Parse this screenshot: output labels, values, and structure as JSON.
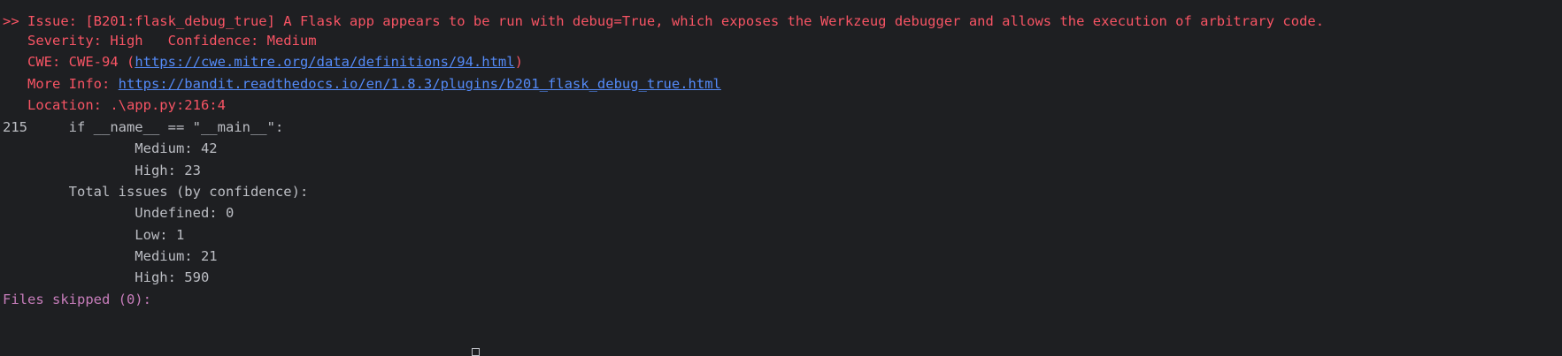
{
  "terminal": {
    "lines": {
      "issue": ">> Issue: [B201:flask_debug_true] A Flask app appears to be run with debug=True, which exposes the Werkzeug debugger and allows the execution of arbitrary code.",
      "severity": "   Severity: High   Confidence: Medium",
      "cwe_prefix": "   CWE: CWE-94 (",
      "cwe_link": "https://cwe.mitre.org/data/definitions/94.html",
      "cwe_suffix": ")",
      "more_info_prefix": "   More Info: ",
      "more_info_link": "https://bandit.readthedocs.io/en/1.8.3/plugins/b201_flask_debug_true.html",
      "location": "   Location: .\\app.py:216:4",
      "code_line": "215     if __name__ == \"__main__\":",
      "sev_medium": "                Medium: 42",
      "sev_high": "                High: 23",
      "total_confidence": "        Total issues (by confidence):",
      "conf_undefined": "                Undefined: 0",
      "conf_low": "                Low: 1",
      "conf_medium": "                Medium: 21",
      "conf_high": "                High: 590",
      "files_skipped": "Files skipped (0):"
    },
    "colors": {
      "background": "#1e1f22",
      "text": "#bcbec4",
      "error": "#f75464",
      "link": "#548af7",
      "magenta": "#c77dbb"
    }
  }
}
